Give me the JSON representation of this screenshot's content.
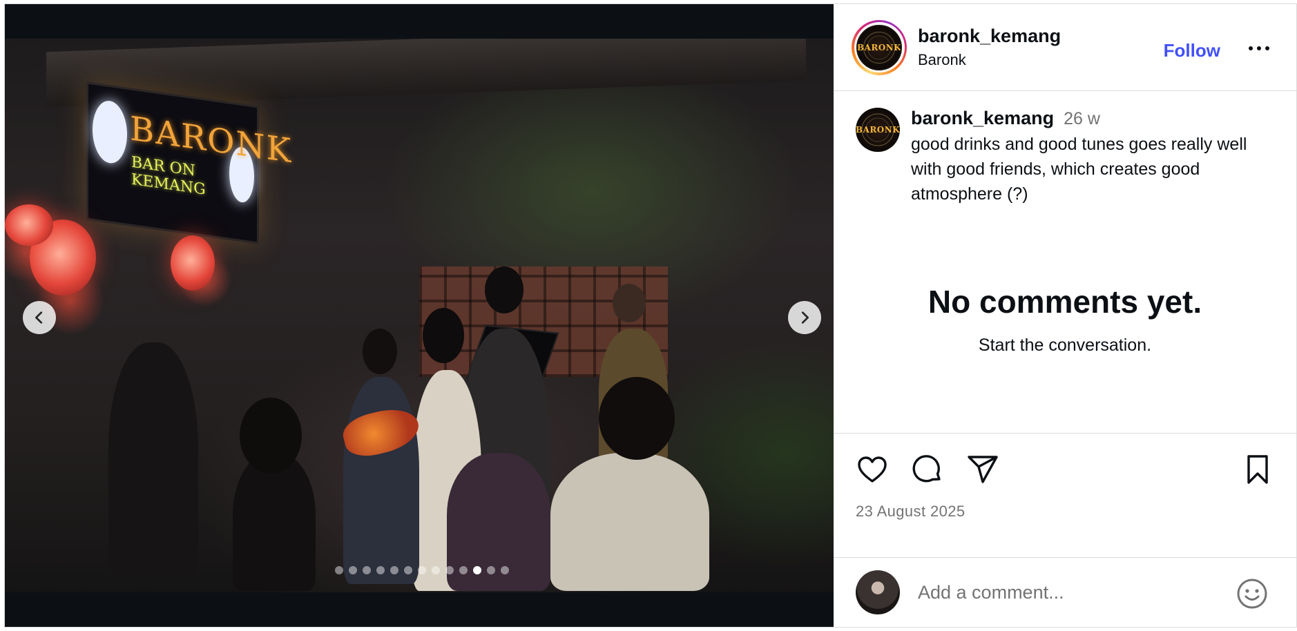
{
  "post": {
    "media": {
      "sign_line1": "BARONK",
      "sign_line2": "BAR ON KEMANG",
      "carousel_count": 13,
      "carousel_active_index": 10
    },
    "header": {
      "username": "baronk_kemang",
      "subtitle": "Baronk",
      "follow_label": "Follow",
      "avatar_text": "BARONK"
    },
    "caption": {
      "username": "baronk_kemang",
      "time": "26 w",
      "text": "good drinks and good tunes goes really well with good friends, which creates good atmosphere (?)"
    },
    "comments": {
      "empty_title": "No comments yet.",
      "empty_subtitle": "Start the conversation."
    },
    "actions": {
      "date": "23 August 2025",
      "icons": [
        "heart-icon",
        "comment-icon",
        "share-icon",
        "bookmark-icon"
      ]
    },
    "comment_box": {
      "placeholder": "Add a comment..."
    }
  },
  "colors": {
    "follow_blue": "#4150f7",
    "muted_text": "#737373",
    "divider": "#dbdbdb",
    "media_bg": "#0c1014"
  }
}
